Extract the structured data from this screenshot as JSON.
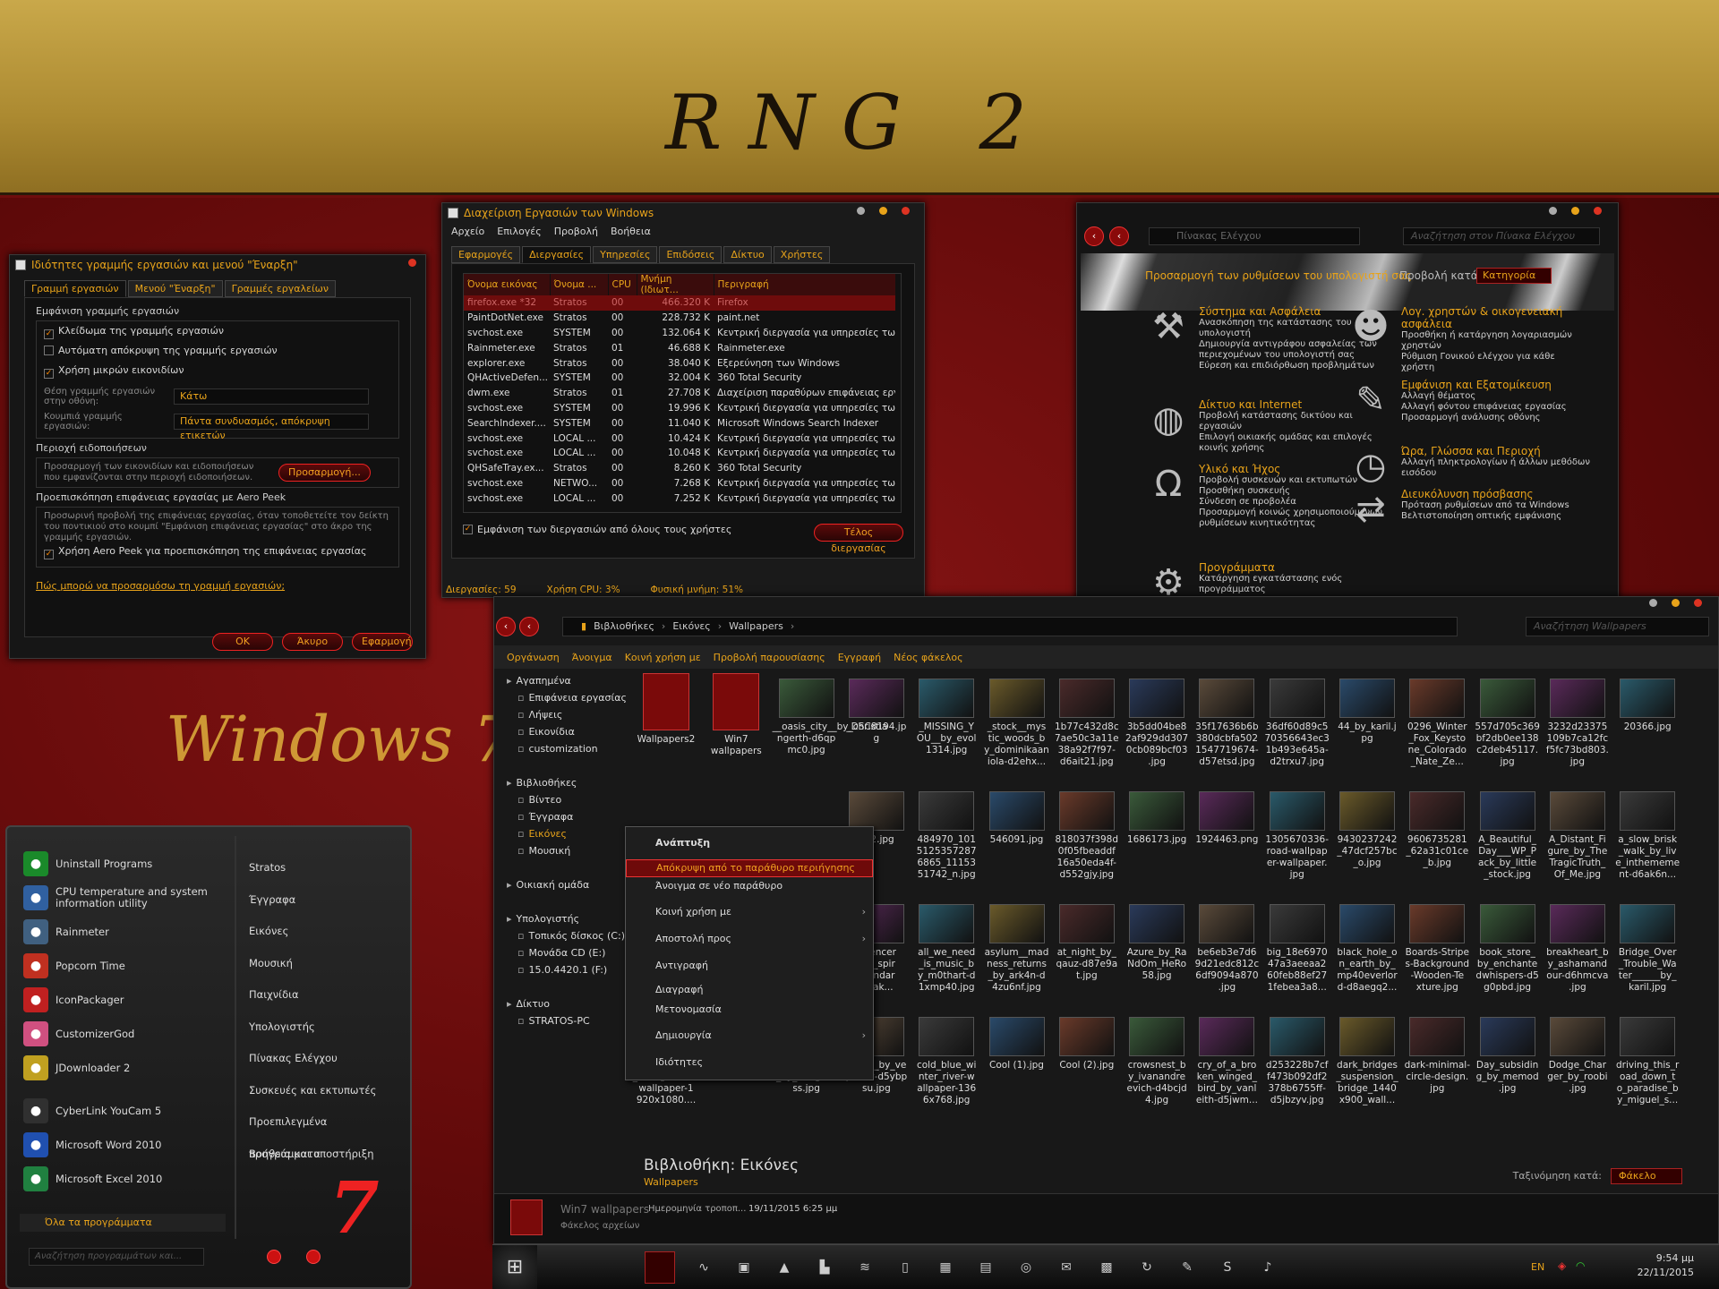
{
  "banner": {
    "title": "RNG 2"
  },
  "wallpaper_text": "Windows 7",
  "taskbar_props": {
    "title": "Ιδιότητες γραμμής εργασιών και μενού \"Έναρξη\"",
    "tabs": [
      "Γραμμή εργασιών",
      "Μενού \"Έναρξη\"",
      "Γραμμές εργαλείων"
    ],
    "group1_title": "Εμφάνιση γραμμής εργασιών",
    "opt_lock": "Κλείδωμα της γραμμής εργασιών",
    "opt_autohide": "Αυτόματη απόκρυψη της γραμμής εργασιών",
    "opt_small": "Χρήση μικρών εικονιδίων",
    "pos_label": "Θέση γραμμής εργασιών στην οθόνη:",
    "pos_value": "Κάτω",
    "buttons_label": "Κουμπιά γραμμής εργασιών:",
    "buttons_value": "Πάντα συνδυασμός, απόκρυψη ετικετών",
    "group2_title": "Περιοχή ειδοποιήσεων",
    "group2_text": "Προσαρμογή των εικονιδίων και ειδοποιήσεων που εμφανίζονται στην περιοχή ειδοποιήσεων.",
    "customize_btn": "Προσαρμογή...",
    "group3_title": "Προεπισκόπηση επιφάνειας εργασίας με Aero Peek",
    "group3_text": "Προσωρινή προβολή της επιφάνειας εργασίας, όταν τοποθετείτε τον δείκτη του ποντικιού στο κουμπί \"Εμφάνιση επιφάνειας εργασίας\" στο άκρο της γραμμής εργασιών.",
    "opt_peek": "Χρήση Aero Peek για προεπισκόπηση της επιφάνειας εργασίας",
    "help_link": "Πώς μπορώ να προσαρμόσω τη γραμμή εργασιών;",
    "ok": "OK",
    "cancel": "Άκυρο",
    "apply": "Εφαρμογή"
  },
  "task_manager": {
    "title": "Διαχείριση Εργασιών των Windows",
    "menu": [
      "Αρχείο",
      "Επιλογές",
      "Προβολή",
      "Βοήθεια"
    ],
    "tabs": [
      "Εφαρμογές",
      "Διεργασίες",
      "Υπηρεσίες",
      "Επιδόσεις",
      "Δίκτυο",
      "Χρήστες"
    ],
    "columns": [
      "Όνομα εικόνας",
      "Όνομα ...",
      "CPU",
      "Μνήμη (Ιδιωτ...",
      "Περιγραφή"
    ],
    "rows": [
      [
        "firefox.exe *32",
        "Stratos",
        "00",
        "466.320 K",
        "Firefox"
      ],
      [
        "PaintDotNet.exe",
        "Stratos",
        "00",
        "228.732 K",
        "paint.net"
      ],
      [
        "svchost.exe",
        "SYSTEM",
        "00",
        "132.064 K",
        "Κεντρική διεργασία για υπηρεσίες των"
      ],
      [
        "Rainmeter.exe",
        "Stratos",
        "01",
        "46.688 K",
        "Rainmeter.exe"
      ],
      [
        "explorer.exe",
        "Stratos",
        "00",
        "38.040 K",
        "Εξερεύνηση των Windows"
      ],
      [
        "QHActiveDefen...",
        "SYSTEM",
        "00",
        "32.004 K",
        "360 Total Security"
      ],
      [
        "dwm.exe",
        "Stratos",
        "01",
        "27.708 K",
        "Διαχείριση παραθύρων επιφάνειας εργ"
      ],
      [
        "svchost.exe",
        "SYSTEM",
        "00",
        "19.996 K",
        "Κεντρική διεργασία για υπηρεσίες των"
      ],
      [
        "SearchIndexer....",
        "SYSTEM",
        "00",
        "11.040 K",
        "Microsoft Windows Search Indexer"
      ],
      [
        "svchost.exe",
        "LOCAL ...",
        "00",
        "10.424 K",
        "Κεντρική διεργασία για υπηρεσίες των"
      ],
      [
        "svchost.exe",
        "LOCAL ...",
        "00",
        "10.048 K",
        "Κεντρική διεργασία για υπηρεσίες των"
      ],
      [
        "QHSafeTray.ex...",
        "Stratos",
        "00",
        "8.260 K",
        "360 Total Security"
      ],
      [
        "svchost.exe",
        "NETWO...",
        "00",
        "7.268 K",
        "Κεντρική διεργασία για υπηρεσίες των"
      ],
      [
        "svchost.exe",
        "LOCAL ...",
        "00",
        "7.252 K",
        "Κεντρική διεργασία για υπηρεσίες των"
      ]
    ],
    "show_all": "Εμφάνιση των διεργασιών από όλους τους χρήστες",
    "end_btn": "Τέλος διεργασίας",
    "status_procs": "Διεργασίες: 59",
    "status_cpu": "Χρήση CPU: 3%",
    "status_mem": "Φυσική μνήμη: 51%"
  },
  "control_panel": {
    "address": "Πίνακας Ελέγχου",
    "search_placeholder": "Αναζήτηση στον Πίνακα Ελέγχου",
    "heading": "Προσαρμογή των ρυθμίσεων του υπολογιστή σας",
    "view_by": "Προβολή κατά:",
    "view_value": "Κατηγορία",
    "left": [
      {
        "icon": "tools-icon",
        "title": "Σύστημα και Ασφάλεια",
        "links": [
          "Ανασκόπηση της κατάστασης του υπολογιστή",
          "Δημιουργία αντιγράφου ασφαλείας των περιεχομένων του υπολογιστή σας",
          "Εύρεση και επιδιόρθωση προβλημάτων"
        ]
      },
      {
        "icon": "globe-icon",
        "title": "Δίκτυο και Internet",
        "links": [
          "Προβολή κατάστασης δικτύου και εργασιών",
          "Επιλογή οικιακής ομάδας και επιλογές κοινής χρήσης"
        ]
      },
      {
        "icon": "headphones-icon",
        "title": "Υλικό και Ήχος",
        "links": [
          "Προβολή συσκευών και εκτυπωτών",
          "Προσθήκη συσκευής",
          "Σύνδεση σε προβολέα",
          "Προσαρμογή κοινώς χρησιμοποιούμενων ρυθμίσεων κινητικότητας"
        ]
      },
      {
        "icon": "gear-icon",
        "title": "Προγράμματα",
        "links": [
          "Κατάργηση εγκατάστασης ενός προγράμματος"
        ]
      }
    ],
    "right": [
      {
        "icon": "users-icon",
        "title": "Λογ. χρηστών & οικογενειακή ασφάλεια",
        "links": [
          "Προσθήκη ή κατάργηση λογαριασμών χρηστών",
          "Ρύθμιση Γονικού ελέγχου για κάθε χρήστη"
        ]
      },
      {
        "icon": "paint-icon",
        "title": "Εμφάνιση και Εξατομίκευση",
        "links": [
          "Αλλαγή θέματος",
          "Αλλαγή φόντου επιφάνειας εργασίας",
          "Προσαρμογή ανάλυσης οθόνης"
        ]
      },
      {
        "icon": "clock-icon",
        "title": "Ώρα, Γλώσσα και Περιοχή",
        "links": [
          "Αλλαγή πληκτρολογίων ή άλλων μεθόδων εισόδου"
        ]
      },
      {
        "icon": "arrows-icon",
        "title": "Διευκόλυνση πρόσβασης",
        "links": [
          "Πρόταση ρυθμίσεων από τα Windows",
          "Βελτιστοποίηση οπτικής εμφάνισης"
        ]
      }
    ]
  },
  "explorer": {
    "breadcrumb": [
      "Βιβλιοθήκες",
      "Εικόνες",
      "Wallpapers"
    ],
    "search_placeholder": "Αναζήτηση Wallpapers",
    "toolbar": [
      "Οργάνωση",
      "Άνοιγμα",
      "Κοινή χρήση με",
      "Προβολή παρουσίασης",
      "Εγγραφή",
      "Νέος φάκελος"
    ],
    "nav": [
      {
        "t": "Αγαπημένα",
        "lvl": 0
      },
      {
        "t": "Επιφάνεια εργασίας",
        "lvl": 1
      },
      {
        "t": "Λήψεις",
        "lvl": 1
      },
      {
        "t": "Εικονίδια",
        "lvl": 1
      },
      {
        "t": "customization",
        "lvl": 1
      },
      {
        "t": "",
        "lvl": 0
      },
      {
        "t": "Βιβλιοθήκες",
        "lvl": 0
      },
      {
        "t": "Βίντεο",
        "lvl": 1
      },
      {
        "t": "Έγγραφα",
        "lvl": 1
      },
      {
        "t": "Εικόνες",
        "lvl": 1
      },
      {
        "t": "Μουσική",
        "lvl": 1
      },
      {
        "t": "",
        "lvl": 0
      },
      {
        "t": "Οικιακή ομάδα",
        "lvl": 0
      },
      {
        "t": "",
        "lvl": 0
      },
      {
        "t": "Υπολογιστής",
        "lvl": 0
      },
      {
        "t": "Τοπικός δίσκος (C:)",
        "lvl": 1
      },
      {
        "t": "Μονάδα CD (E:)",
        "lvl": 1
      },
      {
        "t": "15.0.4420.1 (F:)",
        "lvl": 1
      },
      {
        "t": "",
        "lvl": 0
      },
      {
        "t": "Δίκτυο",
        "lvl": 0
      },
      {
        "t": "STRATOS-PC",
        "lvl": 1
      }
    ],
    "files": [
      "Wallpapers2",
      "Win7 wallpapers",
      "__oasis_city__by_christia ngerth-d6qp mc0.jpg",
      "_DSC8194.jp g",
      "_MISSING_Y OU__by_evol 1314.jpg",
      "_stock__mys tic_woods_b y_dominikaan iola-d2ehx...",
      "1b77c432d8c 7ae50c3a11e 38a92f7f97- d6ait21.jpg",
      "3b5dd04be8 2af929dd307 0cb089bcf03 .jpg",
      "35f17636b6b 380dcbfa502 1547719674- d57etsd.jpg",
      "36df60d89c5 70356643ec3 1b493e645a- d2trxu7.jpg",
      "44_by_karil.j pg",
      "0296_Winter _Fox_Keysto ne_Colorado _Nate_Ze...",
      "557d705c369 bf2db0ee138 c2deb45117. jpg",
      "3232d23375 109b7ca12fc f5fc73bd803. jpg",
      "20366.jpg",
      "",
      "",
      "",
      "712.jpg",
      "484970_101 5125357287 6865_11153 51742_n.jpg",
      "546091.jpg",
      "818037f398d 0f05fbeaddf 16a50eda4f- d552gjy.jpg",
      "1686173.jpg",
      "1924463.png",
      "1305670336- road-wallpap er-wallpaper. jpg",
      "9430237242 _47dcf257bc _o.jpg",
      "9606735281 _62a31c01ce _b.jpg",
      "A_Beautiful_ Day___WP_P ack_by_little _stock.jpg",
      "A_Distant_Fi gure_by_The TragicTruth_ Of_Me.jpg",
      "a_slow_brisk _walk_by_liv e_inthememe nt-d6ak6n...",
      "",
      "",
      "",
      "orfencer ant_spir _sandar wyak...",
      "all_we_need _is_music_b y_m0thart-d 1xmp40.jpg",
      "asylum__mad ness_returns _by_ark4n-d 4zu6nf.jpg",
      "at_night_by_ qauz-d87e9a t.jpg",
      "Azure_by_Ra NdOm_HeRo 58.jpg",
      "be6eb3e7d6 9d21edc812c 6df9094a870 .jpg",
      "big_18e6970 47a3aeeaa2 60feb88ef27 1febea3a8...",
      "black_hole_o n_earth_by_ mp40everlor d-d8aegq2...",
      "Boards-Stripe s-Background -Wooden-Te xture.jpg",
      "book_store_ by_enchante dwhispers-d5 g0pbd.jpg",
      "breakheart_b y_ashamand our-d6hmcva .jpg",
      "Bridge_Over _Trouble_Wa ter______by_ karil.jpg",
      "brown_retro _background -wallpaper-1 920x1080....",
      ".jpg",
      "ne__Vector _by_dangeru ss.jpg",
      "chase_by_ve prikov-d5ybp su.jpg",
      "cold_blue_wi nter_river-w allpaper-136 6x768.jpg",
      "Cool (1).jpg",
      "Cool (2).jpg",
      "crowsnest_b y_ivanandre evich-d4bcjd 4.jpg",
      "cry_of_a_bro ken_winged_ bird_by_vanl eith-d5jwm...",
      "d253228b7cf f473b092df2 378b6755ff- d5jbzyv.jpg",
      "dark_bridges _suspension_ bridge_1440 x900_wall...",
      "dark-minimal- circle-design. jpg",
      "Day_subsidin g_by_memod .jpg",
      "Dodge_Char ger_by_roobi .jpg",
      "driving_this_r oad_down_t o_paradise_b y_miguel_s..."
    ],
    "context_menu": [
      "Ανάπτυξη",
      "Απόκρυψη από το παράθυρο περιήγησης",
      "Άνοιγμα σε νέο παράθυρο",
      "Κοινή χρήση με",
      "Αποστολή προς",
      "Αντιγραφή",
      "Διαγραφή",
      "Μετονομασία",
      "Δημιουργία",
      "Ιδιότητες"
    ],
    "library_title": "Βιβλιοθήκη: Εικόνες",
    "library_sub": "Wallpapers",
    "arrange_label": "Ταξινόμηση κατά:",
    "arrange_value": "Φάκελο",
    "details_name": "Win7 wallpapers",
    "details_date_label": "Ημερομηνία τροποπ...",
    "details_date": "19/11/2015 6:25 μμ",
    "details_type": "Φάκελος αρχείων"
  },
  "start_menu": {
    "programs": [
      {
        "icon": "uninstall-icon",
        "label": "Uninstall Programs",
        "color": "#1a8a2a"
      },
      {
        "icon": "cpu-icon",
        "label": "CPU temperature and system information utility",
        "color": "#3060a0"
      },
      {
        "icon": "rainmeter-icon",
        "label": "Rainmeter",
        "color": "#406080"
      },
      {
        "icon": "popcorn-icon",
        "label": "Popcorn Time",
        "color": "#c03020"
      },
      {
        "icon": "iconpackager-icon",
        "label": "IconPackager",
        "color": "#c02020"
      },
      {
        "icon": "customizergod-icon",
        "label": "CustomizerGod",
        "color": "#d05080"
      },
      {
        "icon": "jdownloader-icon",
        "label": "JDownloader 2",
        "color": "#c0a020"
      },
      {
        "icon": "youcam-icon",
        "label": "CyberLink YouCam 5",
        "color": "#303030"
      },
      {
        "icon": "word-icon",
        "label": "Microsoft Word 2010",
        "color": "#2050b0"
      },
      {
        "icon": "excel-icon",
        "label": "Microsoft Excel 2010",
        "color": "#208040"
      }
    ],
    "all_programs": "Όλα τα προγράμματα",
    "search_placeholder": "Αναζήτηση προγραμμάτων και...",
    "right": [
      "Stratos",
      "Έγγραφα",
      "Εικόνες",
      "Μουσική",
      "Παιχνίδια",
      "Υπολογιστής",
      "Πίνακας Ελέγχου",
      "Συσκευές και εκτυπωτές",
      "Προεπιλεγμένα προγράμματα",
      "Βοήθεια και υποστήριξη"
    ],
    "logo": "7"
  },
  "tray": {
    "lang": "EN",
    "time": "9:54 μμ",
    "date": "22/11/2015"
  }
}
